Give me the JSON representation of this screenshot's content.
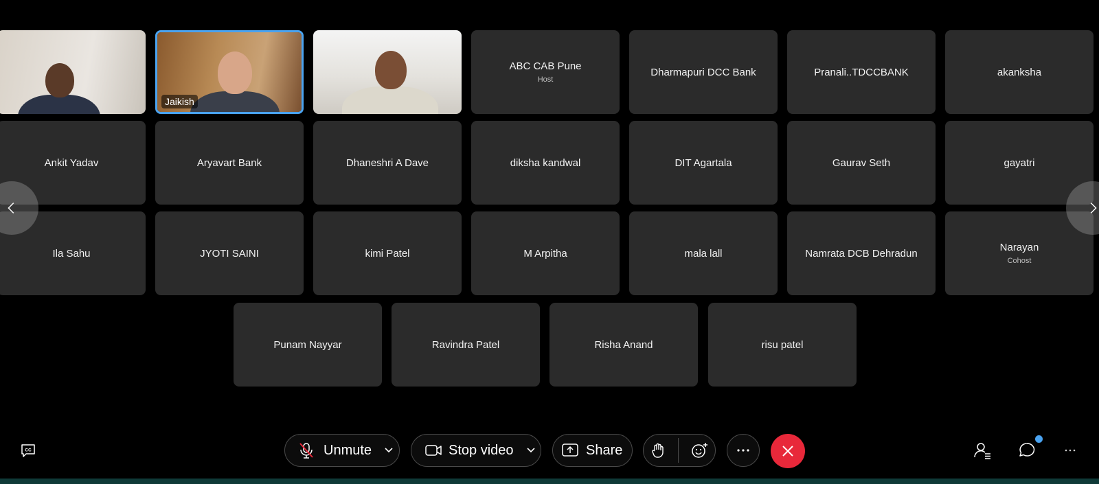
{
  "participants": [
    {
      "name": "",
      "role": "",
      "video": true
    },
    {
      "name": "Jaikish",
      "role": "",
      "video": true,
      "active": true
    },
    {
      "name": "",
      "role": "",
      "video": true
    },
    {
      "name": "ABC CAB Pune",
      "role": "Host"
    },
    {
      "name": "Dharmapuri DCC Bank",
      "role": ""
    },
    {
      "name": "Pranali..TDCCBANK",
      "role": ""
    },
    {
      "name": "akanksha",
      "role": ""
    },
    {
      "name": "Ankit Yadav",
      "role": ""
    },
    {
      "name": "Aryavart Bank",
      "role": ""
    },
    {
      "name": "Dhaneshri A Dave",
      "role": ""
    },
    {
      "name": "diksha kandwal",
      "role": ""
    },
    {
      "name": "DIT Agartala",
      "role": ""
    },
    {
      "name": "Gaurav Seth",
      "role": ""
    },
    {
      "name": "gayatri",
      "role": ""
    },
    {
      "name": "Ila Sahu",
      "role": ""
    },
    {
      "name": "JYOTI SAINI",
      "role": ""
    },
    {
      "name": "kimi Patel",
      "role": ""
    },
    {
      "name": "M Arpitha",
      "role": ""
    },
    {
      "name": "mala lall",
      "role": ""
    },
    {
      "name": "Namrata DCB Dehradun",
      "role": ""
    },
    {
      "name": "Narayan",
      "role": "Cohost"
    },
    {
      "name": "Punam Nayyar",
      "role": ""
    },
    {
      "name": "Ravindra Patel",
      "role": ""
    },
    {
      "name": "Risha Anand",
      "role": ""
    },
    {
      "name": "risu patel",
      "role": ""
    }
  ],
  "toolbar": {
    "unmute_label": "Unmute",
    "stop_video_label": "Stop video",
    "share_label": "Share"
  },
  "icons": {
    "captions": "cc-icon",
    "mic_muted": "mic-off-icon",
    "camera": "camera-icon",
    "share": "share-icon",
    "raise_hand": "hand-icon",
    "reactions": "smiley-plus-icon",
    "more": "more-icon",
    "leave": "close-icon",
    "participants": "participants-icon",
    "chat": "chat-icon"
  },
  "colors": {
    "leave_button": "#e8283a",
    "active_speaker_border": "#4aa3f0",
    "notification_dot": "#4aa3f0"
  }
}
